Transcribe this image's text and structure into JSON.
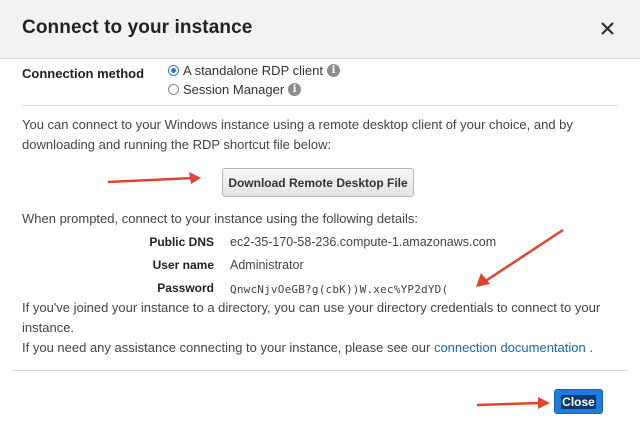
{
  "dialog": {
    "title": "Connect to your instance"
  },
  "connection": {
    "label": "Connection method",
    "options": [
      {
        "label": "A standalone RDP client",
        "selected": true
      },
      {
        "label": "Session Manager",
        "selected": false
      }
    ]
  },
  "intro": {
    "line1": "You can connect to your Windows instance using a remote desktop client of your choice, and by",
    "line2": "downloading and running the RDP shortcut file below:"
  },
  "download_button": "Download Remote Desktop File",
  "details": {
    "prompt": "When prompted, connect to your instance using the following details:",
    "public_dns_label": "Public DNS",
    "public_dns_value": "ec2-35-170-58-236.compute-1.amazonaws.com",
    "username_label": "User name",
    "username_value": "Administrator",
    "password_label": "Password",
    "password_value": "QnwcNjvOeGB?g(cbK))W.xec%YP2dYD("
  },
  "directory": {
    "line1": "If you've joined your instance to a directory, you can use your directory credentials to connect to your",
    "line2": "instance."
  },
  "assistance": {
    "text": "If you need any assistance connecting to your instance, please see our",
    "link": "connection documentation",
    "end": "."
  },
  "footer": {
    "close_label": "Close"
  },
  "colors": {
    "accent": "#1e7be0",
    "arrow": "#e0442f"
  },
  "icons": {
    "close": "close-icon",
    "info": "info-icon"
  }
}
